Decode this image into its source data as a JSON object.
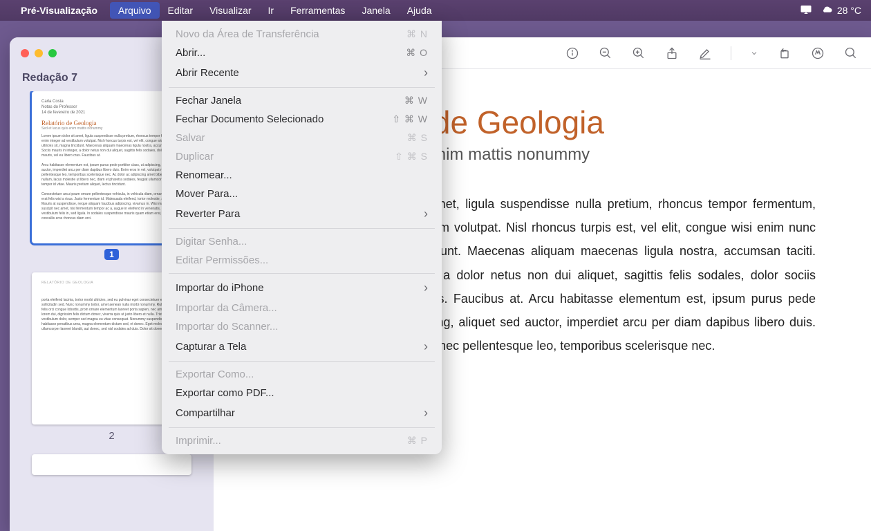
{
  "menubar": {
    "app": "Pré-Visualização",
    "items": [
      "Arquivo",
      "Editar",
      "Visualizar",
      "Ir",
      "Ferramentas",
      "Janela",
      "Ajuda"
    ],
    "active_index": 0,
    "temperature": "28 °C"
  },
  "window": {
    "doc_title": "Redação 7",
    "thumbs": {
      "page1": {
        "badge": "1",
        "meta_name": "Carla Costa",
        "meta_role": "Notas do Professor",
        "meta_date": "14 de fevereiro de 2021",
        "title": "Relatório de Geologia",
        "subtitle": "Sed et lacus quis enim mattis nonummy"
      },
      "page2_label": "2",
      "page2_heading": "RELATÓRIO DE GEOLOGIA"
    },
    "page": {
      "title": "Relatório de Geologia",
      "subtitle": "Sed et lacus quis enim mattis nonummy",
      "body": "Lorem ipsum dolor sit amet, ligula suspendisse nulla pretium, rhoncus tempor fermentum, enim integer ad vestibulum volutpat. Nisl rhoncus turpis est, vel elit, congue wisi enim nunc ultricies sit, magna tincidunt. Maecenas aliquam maecenas ligula nostra, accumsan taciti. Sociis mauris in integer, a dolor netus non dui aliquet, sagittis felis sodales, dolor sociis mauris, vel eu libero cras. Faucibus at. Arcu habitasse elementum est, ipsum purus pede porttitor class, ut adipiscing, aliquet sed auctor, imperdiet arcu per diam dapibus libero duis. Enim eros in vel, volutpat nec pellentesque leo, temporibus scelerisque nec."
    }
  },
  "menu": {
    "groups": [
      [
        {
          "label": "Novo da Área de Transferência",
          "sc": "⌘ N",
          "disabled": true
        },
        {
          "label": "Abrir...",
          "sc": "⌘ O"
        },
        {
          "label": "Abrir Recente",
          "chev": true
        }
      ],
      [
        {
          "label": "Fechar Janela",
          "sc": "⌘ W"
        },
        {
          "label": "Fechar Documento Selecionado",
          "sc": "⇧ ⌘ W"
        },
        {
          "label": "Salvar",
          "sc": "⌘ S",
          "disabled": true
        },
        {
          "label": "Duplicar",
          "sc": "⇧ ⌘ S",
          "disabled": true
        },
        {
          "label": "Renomear..."
        },
        {
          "label": "Mover Para..."
        },
        {
          "label": "Reverter Para",
          "chev": true
        }
      ],
      [
        {
          "label": "Digitar Senha...",
          "disabled": true
        },
        {
          "label": "Editar Permissões...",
          "disabled": true
        }
      ],
      [
        {
          "label": "Importar do iPhone",
          "chev": true
        },
        {
          "label": "Importar da Câmera...",
          "disabled": true
        },
        {
          "label": "Importar do Scanner...",
          "disabled": true
        },
        {
          "label": "Capturar a Tela",
          "chev": true
        }
      ],
      [
        {
          "label": "Exportar Como...",
          "disabled": true
        },
        {
          "label": "Exportar como PDF..."
        },
        {
          "label": "Compartilhar",
          "chev": true
        }
      ],
      [
        {
          "label": "Imprimir...",
          "sc": "⌘ P",
          "disabled": true
        }
      ]
    ]
  }
}
